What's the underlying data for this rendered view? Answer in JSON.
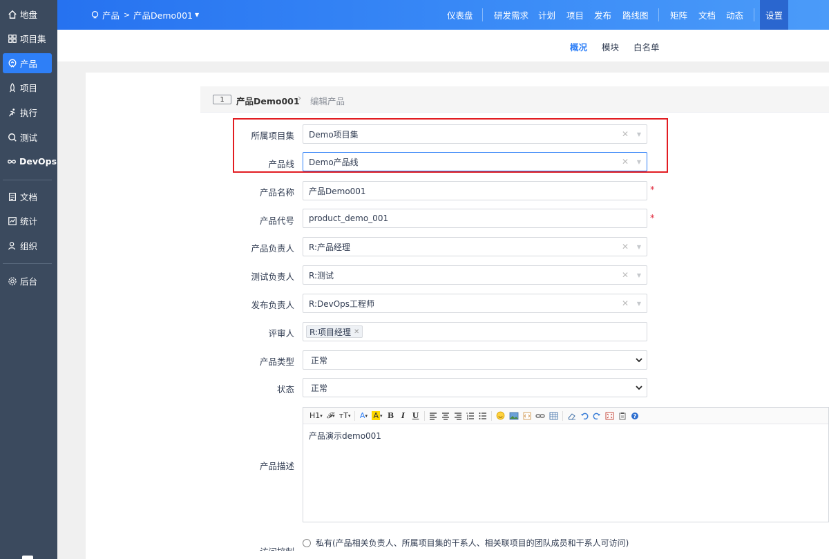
{
  "sidebar": {
    "items": [
      {
        "label": "地盘",
        "icon": "home-icon"
      },
      {
        "label": "项目集",
        "icon": "grid-icon"
      },
      {
        "label": "产品",
        "icon": "product-icon"
      },
      {
        "label": "项目",
        "icon": "rocket-icon"
      },
      {
        "label": "执行",
        "icon": "run-icon"
      },
      {
        "label": "测试",
        "icon": "search-icon"
      },
      {
        "label": "DevOps",
        "icon": "infinity-icon"
      },
      {
        "label": "文档",
        "icon": "document-icon"
      },
      {
        "label": "统计",
        "icon": "chart-icon"
      },
      {
        "label": "组织",
        "icon": "people-icon"
      },
      {
        "label": "后台",
        "icon": "gear-icon"
      }
    ],
    "active": "产品"
  },
  "topbar": {
    "crumb_root": "产品",
    "crumb_current": "产品Demo001",
    "nav": [
      "仪表盘",
      "研发需求",
      "计划",
      "项目",
      "发布",
      "路线图",
      "矩阵",
      "文档",
      "动态",
      "设置"
    ],
    "active": "设置"
  },
  "subnav": {
    "items": [
      "概况",
      "模块",
      "白名单"
    ],
    "active": "概况"
  },
  "header": {
    "id": "1",
    "title": "产品Demo001",
    "subtitle": "编辑产品"
  },
  "form": {
    "program": {
      "label": "所属项目集",
      "value": "Demo项目集"
    },
    "line": {
      "label": "产品线",
      "value": "Demo产品线"
    },
    "name": {
      "label": "产品名称",
      "value": "产品Demo001"
    },
    "code": {
      "label": "产品代号",
      "value": "product_demo_001"
    },
    "po": {
      "label": "产品负责人",
      "value": "R:产品经理"
    },
    "qd": {
      "label": "测试负责人",
      "value": "R:测试"
    },
    "rd": {
      "label": "发布负责人",
      "value": "R:DevOps工程师"
    },
    "reviewer": {
      "label": "评审人",
      "tag": "R:项目经理"
    },
    "type": {
      "label": "产品类型",
      "value": "正常"
    },
    "status": {
      "label": "状态",
      "value": "正常"
    },
    "desc": {
      "label": "产品描述",
      "value": "产品演示demo001"
    },
    "acl": {
      "label": "访问控制",
      "option_private": "私有(产品相关负责人、所属项目集的干系人、相关联项目的团队成员和干系人可访问)"
    }
  },
  "editor_toolbar": [
    "H1",
    "𝓕",
    "тT",
    "A",
    "A",
    "B",
    "I",
    "U"
  ],
  "required_mark": "*",
  "colors": {
    "accent": "#2e7ff7",
    "sidebar": "#3b4a5e",
    "highlight": "#e21c21"
  }
}
